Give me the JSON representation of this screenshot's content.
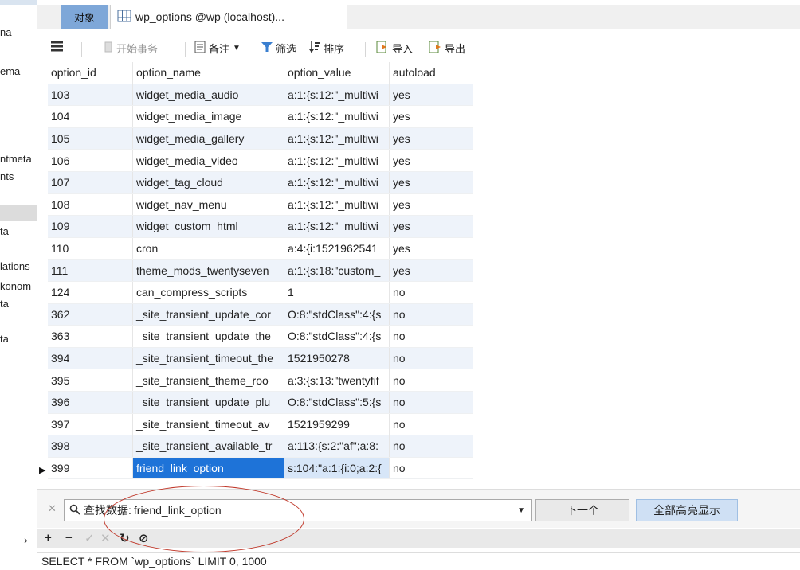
{
  "sidebar": {
    "items": [
      "na",
      "ema",
      "ntmeta",
      "nts",
      "ta",
      "lations",
      "konom",
      "ta",
      "ta"
    ]
  },
  "tabs": {
    "objects": "对象",
    "table": "wp_options @wp (localhost)..."
  },
  "toolbar": {
    "menu_icon": "menu-icon",
    "begin_transaction": "开始事务",
    "note": "备注",
    "filter": "筛选",
    "sort": "排序",
    "import": "导入",
    "export": "导出"
  },
  "grid": {
    "columns": [
      "option_id",
      "option_name",
      "option_value",
      "autoload"
    ],
    "rows": [
      [
        "103",
        "widget_media_audio",
        "a:1:{s:12:\"_multiwi",
        "yes"
      ],
      [
        "104",
        "widget_media_image",
        "a:1:{s:12:\"_multiwi",
        "yes"
      ],
      [
        "105",
        "widget_media_gallery",
        "a:1:{s:12:\"_multiwi",
        "yes"
      ],
      [
        "106",
        "widget_media_video",
        "a:1:{s:12:\"_multiwi",
        "yes"
      ],
      [
        "107",
        "widget_tag_cloud",
        "a:1:{s:12:\"_multiwi",
        "yes"
      ],
      [
        "108",
        "widget_nav_menu",
        "a:1:{s:12:\"_multiwi",
        "yes"
      ],
      [
        "109",
        "widget_custom_html",
        "a:1:{s:12:\"_multiwi",
        "yes"
      ],
      [
        "110",
        "cron",
        "a:4:{i:1521962541",
        "yes"
      ],
      [
        "111",
        "theme_mods_twentyseven",
        "a:1:{s:18:\"custom_",
        "yes"
      ],
      [
        "124",
        "can_compress_scripts",
        "1",
        "no"
      ],
      [
        "362",
        "_site_transient_update_cor",
        "O:8:\"stdClass\":4:{s",
        "no"
      ],
      [
        "363",
        "_site_transient_update_the",
        "O:8:\"stdClass\":4:{s",
        "no"
      ],
      [
        "394",
        "_site_transient_timeout_the",
        "1521950278",
        "no"
      ],
      [
        "395",
        "_site_transient_theme_roo",
        "a:3:{s:13:\"twentyfif",
        "no"
      ],
      [
        "396",
        "_site_transient_update_plu",
        "O:8:\"stdClass\":5:{s",
        "no"
      ],
      [
        "397",
        "_site_transient_timeout_av",
        "1521959299",
        "no"
      ],
      [
        "398",
        "_site_transient_available_tr",
        "a:113:{s:2:\"af\";a:8:",
        "no"
      ],
      [
        "399",
        "friend_link_option",
        "s:104:\"a:1:{i:0;a:2:{",
        "no"
      ]
    ],
    "selected_row": 17
  },
  "find": {
    "label": "查找数据:",
    "value": "friend_link_option",
    "next_label": "下一个",
    "highlight_all_label": "全部高亮显示"
  },
  "status": {
    "sql": "SELECT * FROM `wp_options` LIMIT 0, 1000"
  },
  "colors": {
    "tab_active": "#7ea7d8",
    "selection": "#1e73d8",
    "alt_row": "#eef3fa",
    "annotation": "#c0392b"
  }
}
